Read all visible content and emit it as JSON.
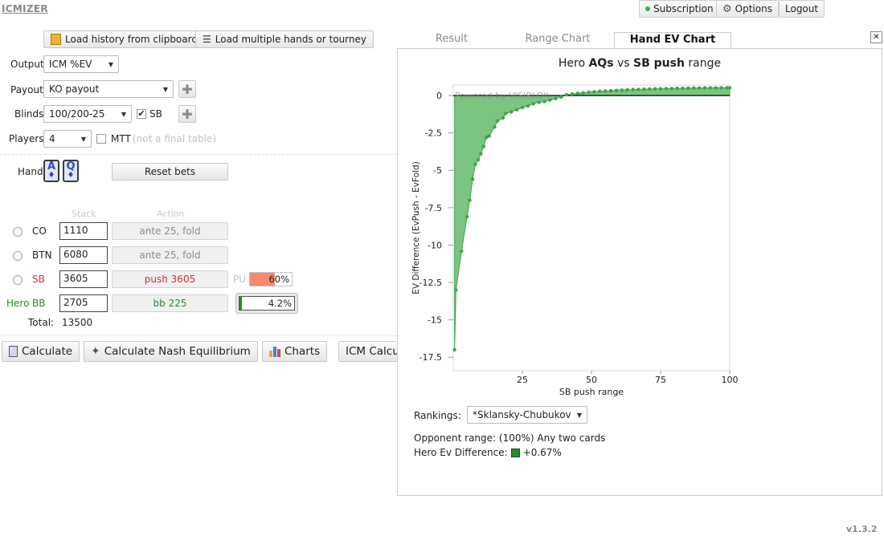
{
  "app": {
    "logo": "ICMIZER",
    "version": "v1.3.2"
  },
  "topnav": {
    "subscription": "Subscription",
    "options": "Options",
    "logout": "Logout"
  },
  "load": {
    "history": "Load history from clipboard",
    "multiple": "Load multiple hands or tourney"
  },
  "form": {
    "output_label": "Output",
    "output_value": "ICM %EV",
    "payout_label": "Payout",
    "payout_value": "KO payout",
    "blinds_label": "Blinds",
    "blinds_value": "100/200-25",
    "sb_label": "SB",
    "players_label": "Players",
    "players_value": "4",
    "mtt_label": "MTT",
    "mtt_note": "(not a final table)",
    "hand_label": "Hand",
    "card1": "A",
    "card2": "Q",
    "suit": "♦",
    "reset_bets": "Reset bets",
    "stack_header": "Stack",
    "action_header": "Action",
    "total_label": "Total:",
    "total_value": "13500",
    "pu_label": "PU"
  },
  "players": [
    {
      "hero": "",
      "position": "CO",
      "stack": "1110",
      "action": "ante 25, fold"
    },
    {
      "hero": "",
      "position": "BTN",
      "stack": "6080",
      "action": "ante 25, fold"
    },
    {
      "hero": "",
      "position": "SB",
      "stack": "3605",
      "action": "push 3605",
      "pct": "60%"
    },
    {
      "hero": "Hero",
      "position": "BB",
      "stack": "2705",
      "action": "bb 225",
      "pct": "4.2%"
    }
  ],
  "bottom": {
    "calculate": "Calculate",
    "nash": "Calculate Nash Equilibrium",
    "charts": "Charts",
    "icm": "ICM Calcu"
  },
  "tabs": {
    "result": "Result",
    "range": "Range Chart",
    "hand_ev": "Hand EV Chart"
  },
  "chart": {
    "title_prefix": "Hero ",
    "hero_hand": "AQs",
    "title_mid": " vs ",
    "villain": "SB push",
    "title_suffix": " range",
    "watermark": "Powered by VISIBLOX",
    "ranking_label": "Rankings:",
    "ranking_value": "*Sklansky-Chubukov",
    "opponent_label": "Opponent range:",
    "opponent_value": "(100%) Any two cards",
    "hero_diff_label": "Hero Ev Difference:",
    "hero_diff_value": "+0.67%"
  },
  "colors": {
    "area": "#7ac57f",
    "point": "#3fa34a",
    "sb_red": "#e03030",
    "hero_green": "#2a8a2a",
    "pu_bar": "#f48a6e"
  },
  "chart_data": {
    "type": "area",
    "xlabel": "SB push range",
    "ylabel": "EV Difference (EvPush - EvFold)",
    "xlim": [
      0,
      100
    ],
    "ylim": [
      -18.4,
      0.7
    ],
    "xticks": [
      25,
      50,
      75,
      100
    ],
    "yticks": [
      0,
      -2.5,
      -5,
      -7.5,
      -10,
      -12.5,
      -15,
      -17.5
    ],
    "grid": false,
    "legend": "none",
    "x": [
      0.5,
      1,
      3,
      5,
      6,
      7,
      8,
      9,
      10,
      11,
      12,
      13,
      15,
      16,
      18,
      19,
      21,
      23,
      25,
      27,
      29,
      31,
      33,
      35,
      37,
      39,
      41,
      43,
      45,
      47,
      49,
      51,
      53,
      55,
      57,
      59,
      61,
      63,
      65,
      67,
      69,
      71,
      73,
      75,
      77,
      79,
      81,
      83,
      85,
      87,
      89,
      91,
      93,
      95,
      97,
      99,
      100
    ],
    "y": [
      -17.0,
      -13.0,
      -10.4,
      -8.1,
      -7.0,
      -5.6,
      -4.6,
      -4.3,
      -3.9,
      -3.4,
      -2.8,
      -2.7,
      -2.1,
      -1.7,
      -1.5,
      -1.2,
      -1.1,
      -0.95,
      -0.8,
      -0.7,
      -0.55,
      -0.45,
      -0.4,
      -0.3,
      -0.2,
      -0.1,
      0.05,
      0.1,
      0.15,
      0.18,
      0.22,
      0.25,
      0.28,
      0.3,
      0.32,
      0.34,
      0.36,
      0.38,
      0.4,
      0.41,
      0.42,
      0.43,
      0.44,
      0.45,
      0.46,
      0.47,
      0.48,
      0.48,
      0.49,
      0.5,
      0.5,
      0.51,
      0.51,
      0.52,
      0.52,
      0.52,
      0.52
    ]
  }
}
